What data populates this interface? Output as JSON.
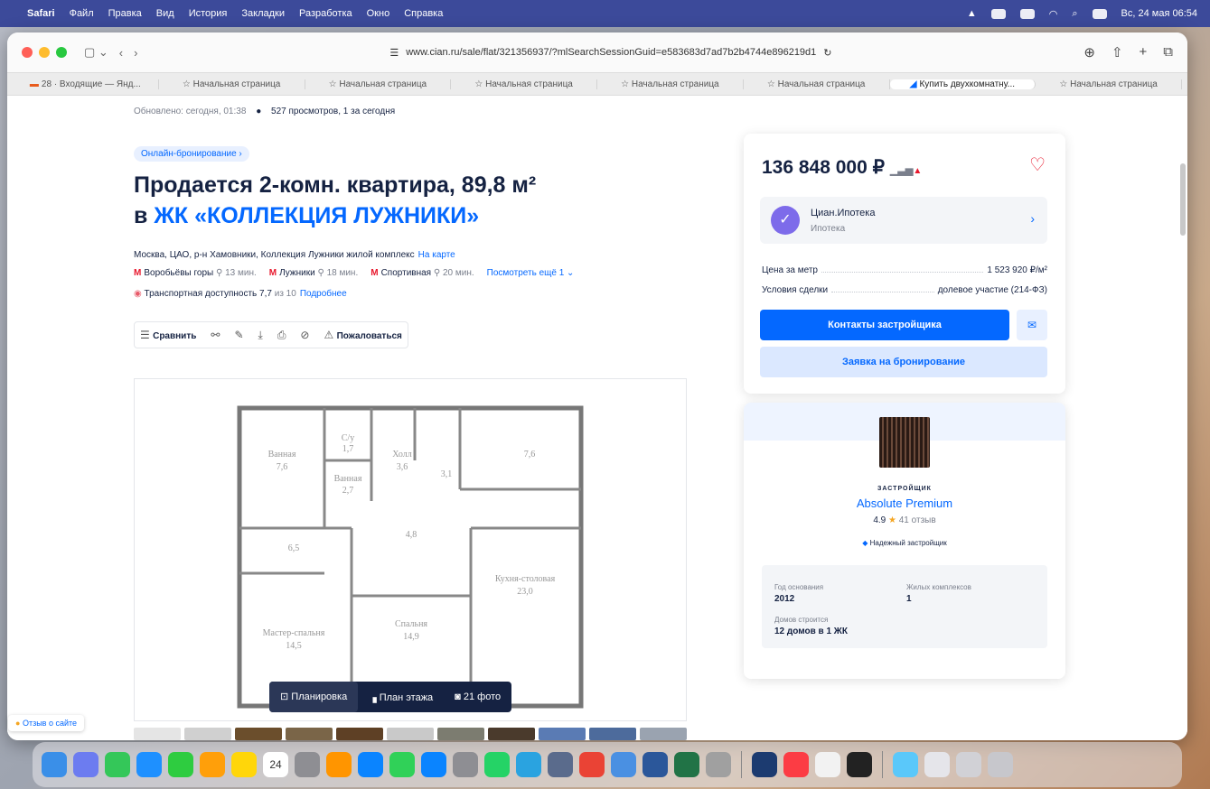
{
  "menubar": {
    "app": "Safari",
    "items": [
      "Файл",
      "Правка",
      "Вид",
      "История",
      "Закладки",
      "Разработка",
      "Окно",
      "Справка"
    ],
    "clock": "Вс, 24 мая 06:54"
  },
  "browser": {
    "url": "www.cian.ru/sale/flat/321356937/?mlSearchSessionGuid=e583683d7ad7b2b4744e896219d1",
    "tabs": [
      "28 · Входящие — Янд...",
      "Начальная страница",
      "Начальная страница",
      "Начальная страница",
      "Начальная страница",
      "Начальная страница",
      "Купить двухкомнатну...",
      "Начальная страница"
    ]
  },
  "listing": {
    "updated": "Обновлено: сегодня, 01:38",
    "views": "527 просмотров, 1 за сегодня",
    "badge": "Онлайн-бронирование",
    "title_line1": "Продается 2-комн. квартира, 89,8 м²",
    "title_prefix": "в",
    "title_complex": "ЖК «КОЛЛЕКЦИЯ ЛУЖНИКИ»",
    "address": "Москва, ЦАО, р-н Хамовники, Коллекция Лужники жилой комплекс",
    "map_link": "На карте",
    "metro": [
      {
        "name": "Воробьёвы горы",
        "time": "13 мин."
      },
      {
        "name": "Лужники",
        "time": "18 мин."
      },
      {
        "name": "Спортивная",
        "time": "20 мин."
      }
    ],
    "metro_more": "Посмотреть ещё 1",
    "transport_label": "Транспортная доступность 7,7",
    "transport_of": "из 10",
    "transport_more": "Подробнее",
    "compare": "Сравнить",
    "complain": "Пожаловаться"
  },
  "plan": {
    "rooms": [
      {
        "n": "Ванная",
        "a": "7,6"
      },
      {
        "n": "С/у",
        "a": "1,7"
      },
      {
        "n": "Холл",
        "a": "3,6"
      },
      {
        "n": "3,1"
      },
      {
        "n": "7,6"
      },
      {
        "n": "Ванная",
        "a": "2,7"
      },
      {
        "n": "6,5"
      },
      {
        "n": "4,8"
      },
      {
        "n": "Кухня-столовая",
        "a": "23,0"
      },
      {
        "n": "Мастер-спальня",
        "a": "14,5"
      },
      {
        "n": "Спальня",
        "a": "14,9"
      }
    ],
    "tab1": "Планировка",
    "tab2": "План этажа",
    "tab3": "21 фото"
  },
  "sidebar": {
    "price": "136 848 000 ₽",
    "ipoteka_name": "Циан.Ипотека",
    "ipoteka_sub": "Ипотека",
    "price_per_m_label": "Цена за метр",
    "price_per_m": "1 523 920 ₽/м²",
    "terms_label": "Условия сделки",
    "terms": "долевое участие (214-ФЗ)",
    "contact_btn": "Контакты застройщика",
    "booking_btn": "Заявка на бронирование"
  },
  "developer": {
    "label": "ЗАСТРОЙЩИК",
    "name": "Absolute Premium",
    "rating": "4.9",
    "reviews": "41 отзыв",
    "reliable": "Надежный застройщик",
    "founded_label": "Год основания",
    "founded": "2012",
    "complexes_label": "Жилых комплексов",
    "complexes": "1",
    "building_label": "Домов строится",
    "building": "12 домов в 1 ЖК"
  },
  "feedback": "Отзыв о сайте"
}
